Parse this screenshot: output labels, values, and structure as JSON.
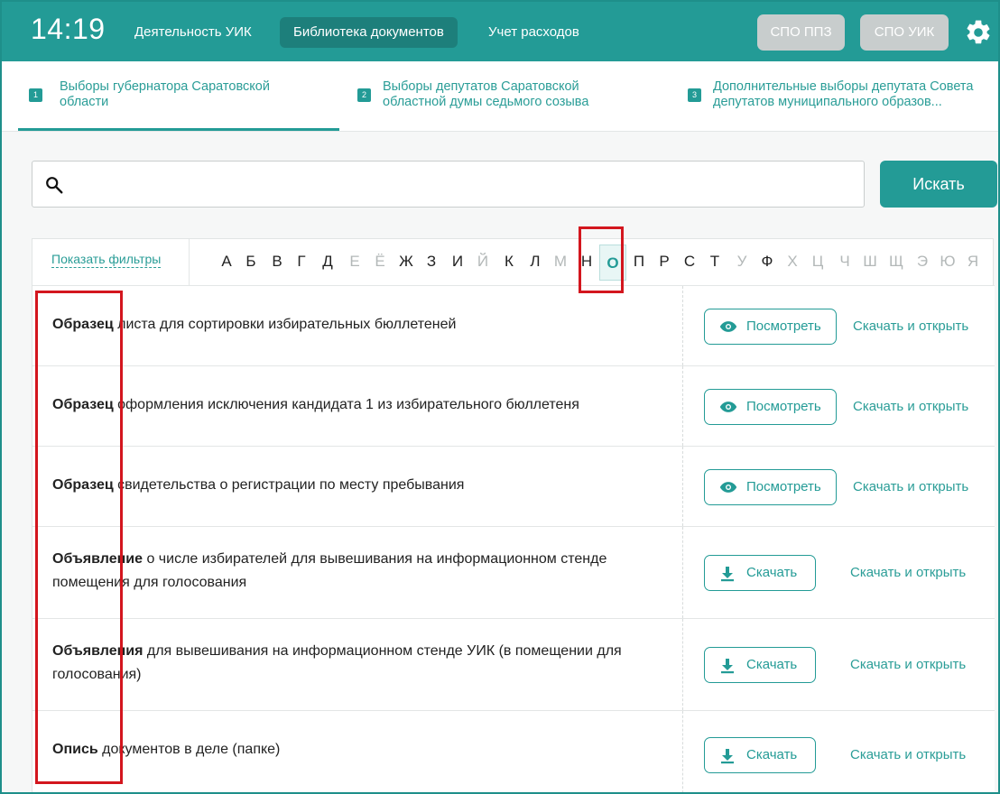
{
  "header": {
    "time": "14:19",
    "nav": [
      "Деятельность УИК",
      "Библиотека документов",
      "Учет расходов"
    ],
    "active_nav": "Библиотека документов",
    "buttons": [
      "СПО ППЗ",
      "СПО УИК"
    ],
    "colors": {
      "accent": "#239b96",
      "accent_dark": "#1d7f7b",
      "disabled": "#c8cdcd",
      "highlight": "#d3161e"
    }
  },
  "elections": [
    {
      "num": "1",
      "line1": "Выборы губернатора Саратовской",
      "line2": "области"
    },
    {
      "num": "2",
      "line1": "Выборы депутатов Саратовской",
      "line2": "областной думы седьмого созыва"
    },
    {
      "num": "3",
      "line1": "Дополнительные выборы депутата Совета",
      "line2": "депутатов муниципального образов..."
    }
  ],
  "search": {
    "placeholder": "",
    "button": "Искать"
  },
  "filters_link": "Показать фильтры",
  "alphabet": {
    "letters": [
      "А",
      "Б",
      "В",
      "Г",
      "Д",
      "Е",
      "Ё",
      "Ж",
      "З",
      "И",
      "Й",
      "К",
      "Л",
      "М",
      "Н",
      "О",
      "П",
      "Р",
      "С",
      "Т",
      "У",
      "Ф",
      "Х",
      "Ц",
      "Ч",
      "Ш",
      "Щ",
      "Э",
      "Ю",
      "Я"
    ],
    "dimmed": [
      "Е",
      "Ё",
      "Й",
      "М",
      "У",
      "Х",
      "Ц",
      "Ч",
      "Ш",
      "Щ",
      "Э",
      "Ю",
      "Я"
    ],
    "active": "О"
  },
  "documents": [
    {
      "bold": "Образец",
      "rest": " листа для сортировки избирательных бюллетеней",
      "action": "Посмотреть",
      "action_icon": "eye-icon",
      "link": "Скачать и открыть"
    },
    {
      "bold": "Образец",
      "rest": " оформления исключения кандидата 1 из избирательного бюллетеня",
      "action": "Посмотреть",
      "action_icon": "eye-icon",
      "link": "Скачать и открыть"
    },
    {
      "bold": "Образец",
      "rest": " свидетельства о регистрации по месту пребывания",
      "action": "Посмотреть",
      "action_icon": "eye-icon",
      "link": "Скачать и открыть"
    },
    {
      "bold": "Объявление",
      "rest": " о числе избирателей для вывешивания на информационном стенде помещения для голосования",
      "action": "Скачать",
      "action_icon": "download-icon",
      "link": "Скачать и открыть"
    },
    {
      "bold": "Объявления",
      "rest": " для вывешивания на информационном стенде УИК (в помещении для голосования)",
      "action": "Скачать",
      "action_icon": "download-icon",
      "link": "Скачать и открыть"
    },
    {
      "bold": "Опись",
      "rest": " документов в деле (папке)",
      "action": "Скачать",
      "action_icon": "download-icon",
      "link": "Скачать и открыть"
    }
  ]
}
